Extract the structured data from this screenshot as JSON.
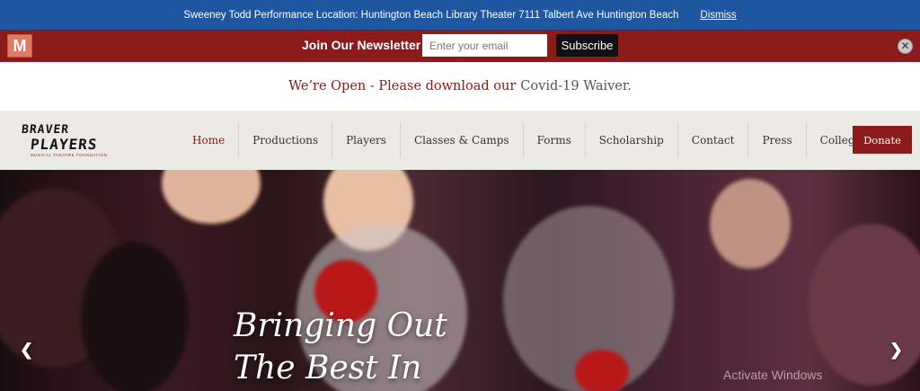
{
  "topbar": {
    "message": "Sweeney Todd Performance Location: Huntington Beach Library Theater 7111 Talbert Ave Huntington Beach",
    "dismiss_label": "Dismiss"
  },
  "newsletter": {
    "logo_letter": "M",
    "label": "Join Our Newsletter",
    "email_placeholder": "Enter your email",
    "subscribe_label": "Subscribe",
    "close_glyph": "✕"
  },
  "notice": {
    "text": "We’re Open - Please download our",
    "link": "Covid-19 Waiver."
  },
  "logo": {
    "line1": "BRAVER",
    "line2": "PLAYERS",
    "tagline": "MUSICAL THEATRE FOUNDATION"
  },
  "nav": {
    "items": [
      "Home",
      "Productions",
      "Players",
      "Classes & Camps",
      "Forms",
      "Scholarship",
      "Contact",
      "Press",
      "College Corner"
    ],
    "active": "Home",
    "donate_label": "Donate"
  },
  "hero": {
    "headline_line1": "Bringing Out",
    "headline_line2": "The Best In",
    "prev_glyph": "❮",
    "next_glyph": "❯"
  },
  "watermark": "Activate Windows",
  "colors": {
    "topbar_bg": "#1e56a0",
    "brand_red": "#8b1a1a",
    "nav_bg": "#eceae4"
  }
}
